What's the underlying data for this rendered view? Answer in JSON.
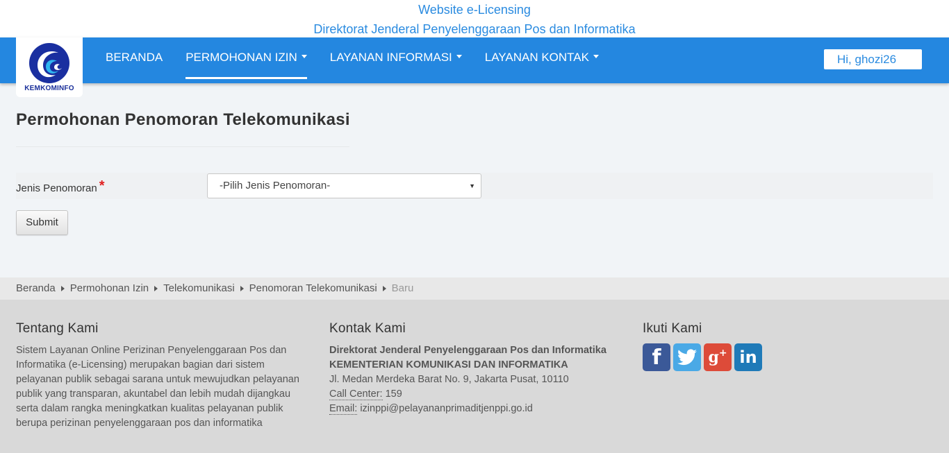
{
  "banner": {
    "line1": "Website e-Licensing",
    "line2": "Direktorat Jenderal Penyelenggaraan Pos dan Informatika"
  },
  "logo": {
    "text": "KEMKOMINFO"
  },
  "nav": {
    "items": [
      {
        "label": "BERANDA",
        "dropdown": false,
        "active": false
      },
      {
        "label": "PERMOHONAN IZIN",
        "dropdown": true,
        "active": true
      },
      {
        "label": "LAYANAN INFORMASI",
        "dropdown": true,
        "active": false
      },
      {
        "label": "LAYANAN KONTAK",
        "dropdown": true,
        "active": false
      }
    ],
    "user_greeting": "Hi, ghozi26"
  },
  "page": {
    "title": "Permohonan Penomoran Telekomunikasi",
    "form": {
      "field_label": "Jenis Penomoran",
      "required_mark": "*",
      "select_value": "-Pilih Jenis Penomoran-",
      "submit_label": "Submit"
    }
  },
  "breadcrumb": [
    "Beranda",
    "Permohonan Izin",
    "Telekomunikasi",
    "Penomoran Telekomunikasi",
    "Baru"
  ],
  "footer": {
    "about": {
      "heading": "Tentang Kami",
      "text": "Sistem Layanan Online Perizinan Penyelenggaraan Pos dan Informatika (e-Licensing) merupakan bagian dari sistem pelayanan publik sebagai sarana untuk mewujudkan pelayanan publik yang transparan, akuntabel dan lebih mudah dijangkau serta dalam rangka meningkatkan kualitas pelayanan publik berupa perizinan penyelenggaraan pos dan informatika"
    },
    "contact": {
      "heading": "Kontak Kami",
      "org1": "Direktorat Jenderal Penyelenggaraan Pos dan Informatika",
      "org2": "KEMENTERIAN KOMUNIKASI DAN INFORMATIKA",
      "address": "Jl. Medan Merdeka Barat No. 9, Jakarta Pusat, 10110",
      "call_label": "Call Center:",
      "call_value": " 159",
      "email_label": "Email:",
      "email_value": " izinppi@pelayananprimaditjenppi.go.id"
    },
    "follow": {
      "heading": "Ikuti Kami",
      "icons": [
        "facebook-icon",
        "twitter-icon",
        "google-plus-icon",
        "linkedin-icon"
      ]
    }
  },
  "colors": {
    "nav_blue": "#2487e0",
    "banner_text": "#2a8be0",
    "required": "#e02020"
  }
}
